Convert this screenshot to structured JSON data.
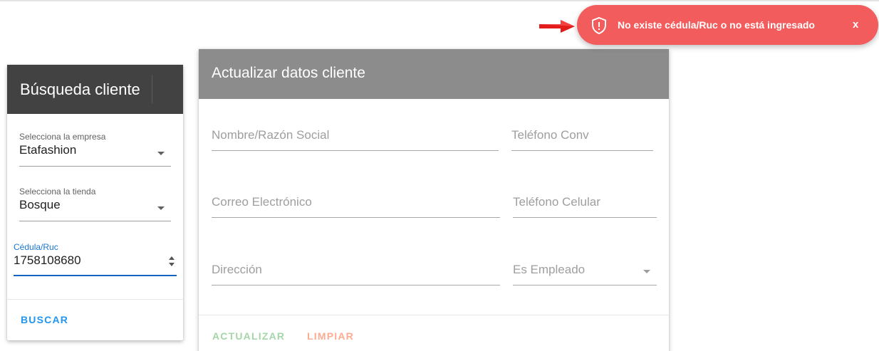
{
  "search_card": {
    "title": "Búsqueda cliente",
    "empresa": {
      "label": "Selecciona la empresa",
      "value": "Etafashion"
    },
    "tienda": {
      "label": "Selecciona la tienda",
      "value": "Bosque"
    },
    "cedula": {
      "label": "Cédula/Ruc",
      "value": "1758108680"
    },
    "buscar_label": "BUSCAR"
  },
  "update_card": {
    "title": "Actualizar datos cliente",
    "fields": {
      "nombre": "Nombre/Razón Social",
      "telefono_conv": "Teléfono Conv",
      "correo": "Correo Electrónico",
      "telefono_celular": "Teléfono Celular",
      "direccion": "Dirección",
      "es_empleado": "Es Empleado"
    },
    "actualizar_label": "ACTUALIZAR",
    "limpiar_label": "LIMPIAR"
  },
  "toast": {
    "message": "No existe cédula/Ruc o no está ingresado",
    "close_label": "x",
    "icon": "shield-alert-icon"
  },
  "colors": {
    "header_dark": "#424242",
    "header_gray": "#8c8c8c",
    "primary": "#2196f3",
    "toast_red": "#f25c5c",
    "actualizar": "#a5d6a7",
    "limpiar": "#ffab91"
  }
}
